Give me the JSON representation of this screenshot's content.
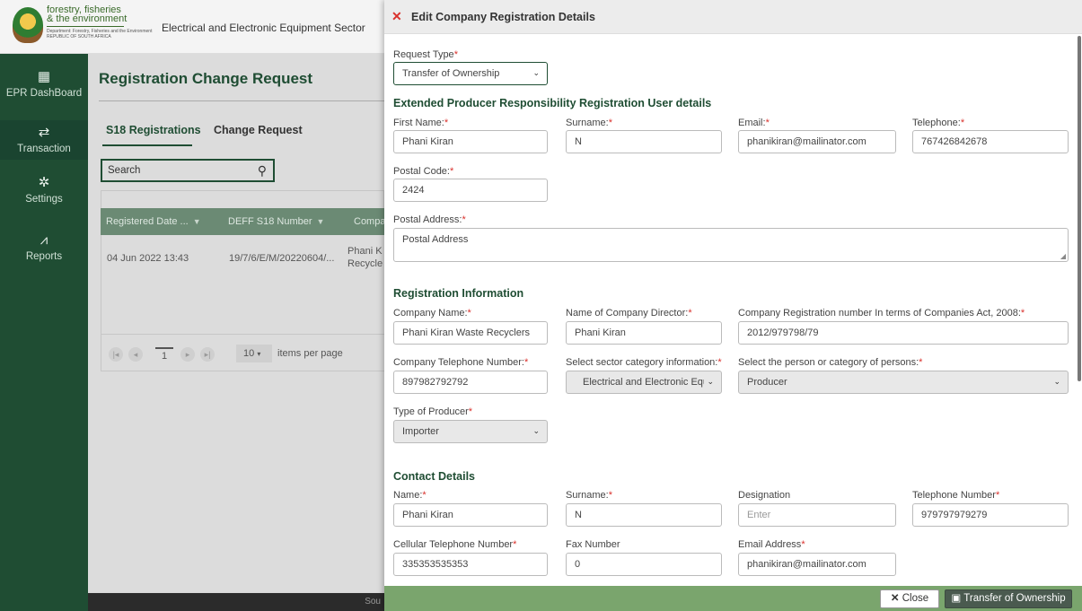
{
  "header": {
    "logo_line1": "forestry, fisheries",
    "logo_line2": "& the environment",
    "logo_small": "Department: Forestry, Fisheries and the Environment REPUBLIC OF SOUTH AFRICA",
    "sector_title": "Electrical and Electronic Equipment Sector"
  },
  "sidebar": {
    "items": [
      {
        "label": "EPR DashBoard",
        "icon": "grid-icon"
      },
      {
        "label": "Transaction",
        "icon": "exchange-icon"
      },
      {
        "label": "Settings",
        "icon": "gears-icon"
      },
      {
        "label": "Reports",
        "icon": "chart-line-icon"
      }
    ]
  },
  "main": {
    "title": "Registration Change Request",
    "tabs": [
      "S18 Registrations",
      "Change Request"
    ],
    "search_label": "Search",
    "columns": [
      "Registered Date ...",
      "DEFF S18 Number",
      "Compa"
    ],
    "row": {
      "date": "04 Jun 2022 13:43",
      "number": "19/7/6/E/M/20220604/...",
      "company1": "Phani K",
      "company2": "Recycle"
    },
    "pager": {
      "page": "1",
      "page_size": "10",
      "per_page_text": "items per page"
    },
    "footer_fragment": "Sou"
  },
  "panel": {
    "title": "Edit Company Registration Details",
    "request_type_label": "Request Type",
    "request_type_value": "Transfer of Ownership",
    "section_user": "Extended Producer Responsibility Registration User details",
    "user": {
      "first_name_label": "First Name:",
      "first_name": "Phani Kiran",
      "surname_label": "Surname:",
      "surname": "N",
      "email_label": "Email:",
      "email": "phanikiran@mailinator.com",
      "telephone_label": "Telephone:",
      "telephone": "767426842678",
      "postal_code_label": "Postal Code:",
      "postal_code": "2424",
      "postal_address_label": "Postal Address:",
      "postal_address": "Postal Address"
    },
    "section_registration": "Registration Information",
    "registration": {
      "company_name_label": "Company Name:",
      "company_name": "Phani Kiran Waste Recyclers",
      "director_label": "Name of Company Director:",
      "director": "Phani Kiran",
      "reg_no_label": "Company Registration number In terms of Companies Act, 2008:",
      "reg_no": "2012/979798/79",
      "company_tel_label": "Company Telephone Number:",
      "company_tel": "897982792792",
      "sector_label": "Select sector category information:",
      "sector": "Electrical and Electronic Equi",
      "person_label": "Select the person or category of persons:",
      "person": "Producer",
      "producer_type_label": "Type of Producer",
      "producer_type": "Importer"
    },
    "section_contact": "Contact Details",
    "contact": {
      "name_label": "Name:",
      "name": "Phani Kiran",
      "surname_label": "Surname:",
      "surname": "N",
      "designation_label": "Designation",
      "designation_placeholder": "Enter",
      "tel_label": "Telephone Number",
      "tel": "979797979279",
      "cell_label": "Cellular Telephone Number",
      "cell": "335353535353",
      "fax_label": "Fax Number",
      "fax": "0",
      "email_label": "Email Address",
      "email": "phanikiran@mailinator.com"
    },
    "buttons": {
      "close": "Close",
      "transfer": "Transfer of Ownership"
    }
  },
  "colors": {
    "brand_green": "#1f4d33",
    "footer_green": "#7aa56d",
    "required": "#d9312c"
  }
}
